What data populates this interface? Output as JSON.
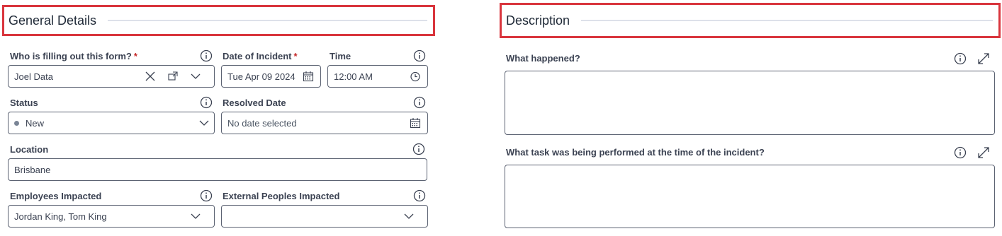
{
  "general": {
    "title": "General Details",
    "who_label": "Who is filling out this form?",
    "who_value": "Joel Data",
    "date_label": "Date of Incident",
    "date_value": "Tue Apr 09 2024",
    "time_label": "Time",
    "time_value": "12:00 AM",
    "status_label": "Status",
    "status_value": "New",
    "resolved_label": "Resolved Date",
    "resolved_placeholder": "No date selected",
    "location_label": "Location",
    "location_value": "Brisbane",
    "employees_label": "Employees Impacted",
    "employees_value": "Jordan King, Tom King",
    "external_label": "External Peoples Impacted",
    "external_value": "",
    "required_marker": "*"
  },
  "description": {
    "title": "Description",
    "q1_label": "What happened?",
    "q1_value": "",
    "q2_label": "What task was being performed at the time of the incident?",
    "q2_value": ""
  },
  "icons": [
    "info-icon",
    "clear-icon",
    "open-record-icon",
    "chevron-down-icon",
    "calendar-icon",
    "clock-icon",
    "expand-icon"
  ],
  "colors": {
    "highlight": "#d9353d",
    "required": "#c62828",
    "border": "#5b6272",
    "status_dot": "#7a8596"
  }
}
